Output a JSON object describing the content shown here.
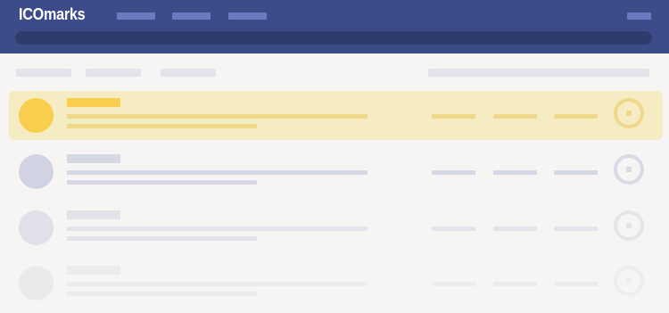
{
  "brand": {
    "logo_text": "ICOmarks"
  },
  "colors": {
    "topbar": "#3c4c89",
    "nav_placeholder": "#6b7bc0",
    "search_bar": "#2e3b6d",
    "page_bg": "#f6f5f3",
    "active_row_bg": "#f6ecc4",
    "active_accent": "#f9ce4e",
    "inactive_accent": "#d1d3e2"
  },
  "rows": [
    {
      "state": "active",
      "opacity": 1.0
    },
    {
      "state": "inactive",
      "opacity": 1.0
    },
    {
      "state": "inactive",
      "opacity": 0.6
    },
    {
      "state": "inactive",
      "opacity": 0.3
    }
  ]
}
